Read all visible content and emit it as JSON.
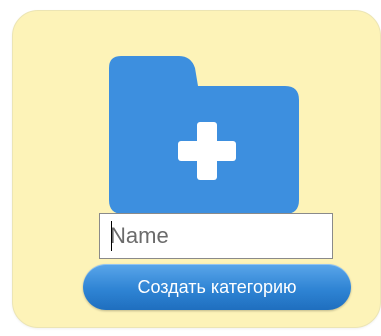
{
  "panel": {
    "background_color": "#fdf3b8",
    "folder_icon": {
      "name": "folder-add-icon",
      "color": "#3d8fdf",
      "plus_color": "#ffffff"
    },
    "name_input": {
      "value": "",
      "placeholder": "Name"
    },
    "create_button": {
      "label": "Создать категорию",
      "color": "#2f84d4"
    }
  }
}
